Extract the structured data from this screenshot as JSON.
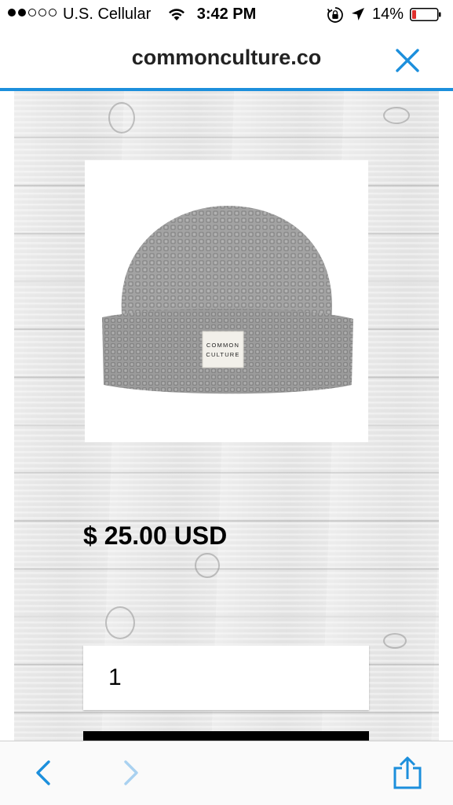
{
  "status_bar": {
    "carrier": "U.S. Cellular",
    "time": "3:42 PM",
    "battery": "14%",
    "signal_bars_filled": 2,
    "signal_bars_total": 5
  },
  "header": {
    "domain": "commonculture.co"
  },
  "product": {
    "image_icon": "beanie-image",
    "label_line1": "COMMON",
    "label_line2": "CULTURE",
    "price": "$ 25.00 USD"
  },
  "form": {
    "quantity_value": "1"
  },
  "colors": {
    "accent": "#1c8fdc",
    "toolbar_icon": "#1c8fdc",
    "toolbar_icon_disabled": "#a9d1f0",
    "battery_low": "#e0312e"
  },
  "icons": {
    "close": "close-icon",
    "back": "chevron-left-icon",
    "forward": "chevron-right-icon",
    "share": "share-icon"
  }
}
